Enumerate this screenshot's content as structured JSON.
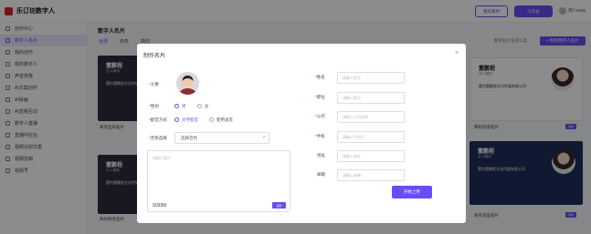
{
  "header": {
    "app_name": "乐订坊数字人",
    "btn_outline": "我的素材",
    "btn_filled": "工作台",
    "user_name": "用户2056"
  },
  "sidebar": {
    "items": [
      {
        "label": "创作中心",
        "active": false
      },
      {
        "label": "数字人名片",
        "active": true
      },
      {
        "label": "我的创作",
        "active": false
      },
      {
        "label": "我的数字人",
        "active": false
      },
      {
        "label": "声音克隆",
        "active": false
      },
      {
        "label": "AI文案创作",
        "active": false
      },
      {
        "label": "AI绘画",
        "active": false
      },
      {
        "label": "AI直播互动",
        "active": false
      },
      {
        "label": "数字人直播",
        "active": false
      },
      {
        "label": "直播中控台",
        "active": false
      },
      {
        "label": "视频识别文案",
        "active": false
      },
      {
        "label": "视频剪辑",
        "active": false
      },
      {
        "label": "视频号",
        "active": false
      }
    ]
  },
  "main": {
    "title": "数字人名片",
    "tabs": [
      "全部",
      "商务",
      "简约"
    ],
    "tools_text": "数字名片生成工具",
    "tools_button": "+ 制作数字人名片",
    "cards": [
      {
        "name": "董鹏程",
        "role": "艺人/模特",
        "org": "董怡董鹏程文化传媒有限公司"
      },
      {
        "name": "董鹏程",
        "role": "艺人/模特",
        "org": "董怡董鹏程文化传媒有限公司"
      },
      {
        "name": "董鹏程",
        "role": "艺人/模特",
        "org": "董怡董鹏程文化传媒有限公司"
      },
      {
        "name": "董鹏程",
        "role": "艺人/模特",
        "org": "董怡董鹏程文化传媒有限公司"
      }
    ],
    "card_labels": [
      "商务蓝白名片",
      "简约商务名片",
      "简约白底名片",
      "商务深蓝名片"
    ],
    "card_tag": "使用"
  },
  "modal": {
    "title": "制作名片",
    "close": "×",
    "avatar_label": "头像",
    "gender_label": "性别",
    "gender_options": [
      {
        "label": "男",
        "selected": true
      },
      {
        "label": "女",
        "selected": false
      }
    ],
    "voice_label": "配音方式",
    "voice_options": [
      {
        "label": "文字配音",
        "selected": true
      },
      {
        "label": "使用录音",
        "selected": false
      }
    ],
    "sound_label": "音色选择",
    "sound_placeholder": "选择音色",
    "text_placeholder": "请输入简介",
    "text_count": "0/3000",
    "text_button": "试听",
    "fields": [
      {
        "label": "姓名",
        "placeholder": "请输入姓名"
      },
      {
        "label": "职位",
        "placeholder": "请输入职位"
      },
      {
        "label": "公司",
        "placeholder": "请输入公司名称"
      },
      {
        "label": "手机",
        "placeholder": "请输入手机号"
      },
      {
        "label": "地址",
        "placeholder": "请输入地址"
      },
      {
        "label": "邮箱",
        "placeholder": "请输入邮箱"
      }
    ],
    "submit": "开始上传"
  },
  "colors": {
    "accent": "#6b4cf5",
    "overlay": "rgba(0,0,0,0.45)"
  }
}
